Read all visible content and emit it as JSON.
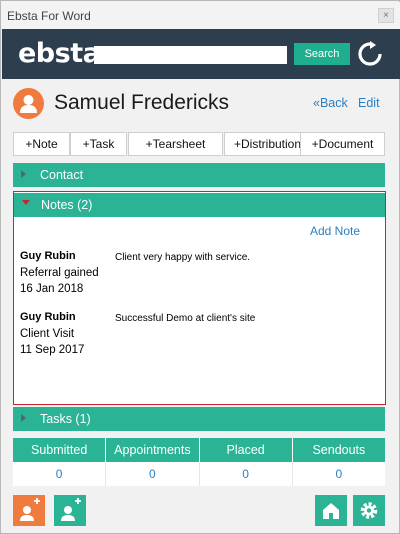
{
  "window": {
    "title": "Ebsta For Word",
    "close_glyph": "×"
  },
  "header": {
    "logo": "ebsta",
    "search": {
      "value": "",
      "placeholder": ""
    },
    "search_label": "Search",
    "refresh_icon": "refresh-icon"
  },
  "profile": {
    "name": "Samuel Fredericks",
    "back_label": "«Back",
    "edit_label": "Edit",
    "avatar_icon": "user-icon"
  },
  "actions": [
    "+Note",
    "+Task",
    "+Tearsheet",
    "+Distribution",
    "+Document"
  ],
  "sections": {
    "contact": {
      "label": "Contact",
      "expanded": false
    },
    "notes": {
      "label": "Notes (2)",
      "expanded": true,
      "add_label": "Add Note",
      "items": [
        {
          "author": "Guy Rubin",
          "type": "Referral gained",
          "date": "16 Jan 2018",
          "text": "Client very happy with service."
        },
        {
          "author": "Guy Rubin",
          "type": "Client Visit",
          "date": "11 Sep 2017",
          "text": "Successful Demo at client's site"
        }
      ]
    },
    "tasks": {
      "label": "Tasks (1)",
      "expanded": false
    }
  },
  "stats": {
    "headers": [
      "Submitted",
      "Appointments",
      "Placed",
      "Sendouts"
    ],
    "values": [
      "0",
      "0",
      "0",
      "0"
    ]
  },
  "colors": {
    "header_bg": "#2d3e4e",
    "accent_green": "#2bb396",
    "orange": "#f07b3f",
    "link_blue": "#2b7fc3",
    "highlight_red": "#c1272d"
  },
  "footer_buttons": [
    "add-contact-icon",
    "add-user-icon",
    "home-icon",
    "settings-icon"
  ]
}
